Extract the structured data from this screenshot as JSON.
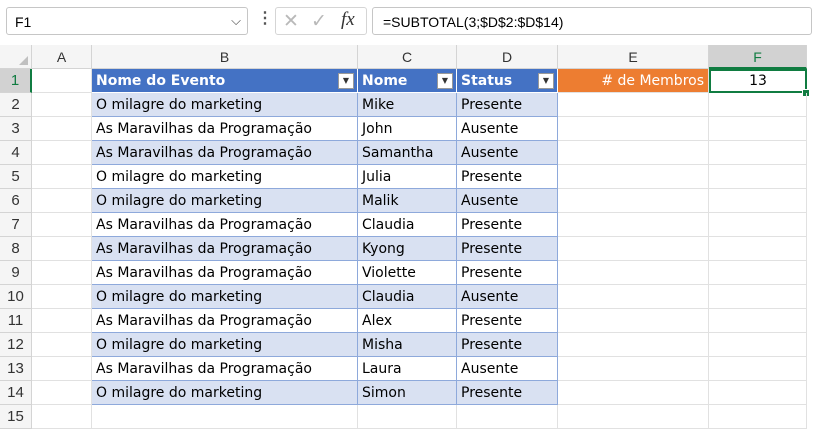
{
  "name_box": "F1",
  "formula": "=SUBTOTAL(3;$D$2:$D$14)",
  "icons": [
    "chevron-down-icon",
    "more-vertical-icon",
    "cancel-icon",
    "confirm-icon",
    "function-icon"
  ],
  "columns": [
    "A",
    "B",
    "C",
    "D",
    "E",
    "F"
  ],
  "rows": [
    "1",
    "2",
    "3",
    "4",
    "5",
    "6",
    "7",
    "8",
    "9",
    "10",
    "11",
    "12",
    "13",
    "14",
    "15"
  ],
  "table": {
    "headers": [
      "Nome do Evento",
      "Nome",
      "Status"
    ],
    "rows": [
      [
        "O milagre do marketing",
        "Mike",
        "Presente"
      ],
      [
        "As Maravilhas da Programação",
        "John",
        "Ausente"
      ],
      [
        "As Maravilhas da Programação",
        "Samantha",
        "Ausente"
      ],
      [
        "O milagre do marketing",
        "Julia",
        "Presente"
      ],
      [
        "O milagre do marketing",
        "Malik",
        "Ausente"
      ],
      [
        "As Maravilhas da Programação",
        "Claudia",
        "Presente"
      ],
      [
        "As Maravilhas da Programação",
        "Kyong",
        "Presente"
      ],
      [
        "As Maravilhas da Programação",
        "Violette",
        "Presente"
      ],
      [
        "O milagre do marketing",
        "Claudia",
        "Ausente"
      ],
      [
        "As Maravilhas da Programação",
        "Alex",
        "Presente"
      ],
      [
        "O milagre do marketing",
        "Misha",
        "Presente"
      ],
      [
        "As Maravilhas da Programação",
        "Laura",
        "Ausente"
      ],
      [
        "O milagre do marketing",
        "Simon",
        "Presente"
      ]
    ]
  },
  "e1_label": "# de Membros",
  "f1_value": "13",
  "colors": {
    "table_header": "#4472c4",
    "band": "#d9e1f2",
    "label_fill": "#ed7d31",
    "selection": "#107c41"
  }
}
